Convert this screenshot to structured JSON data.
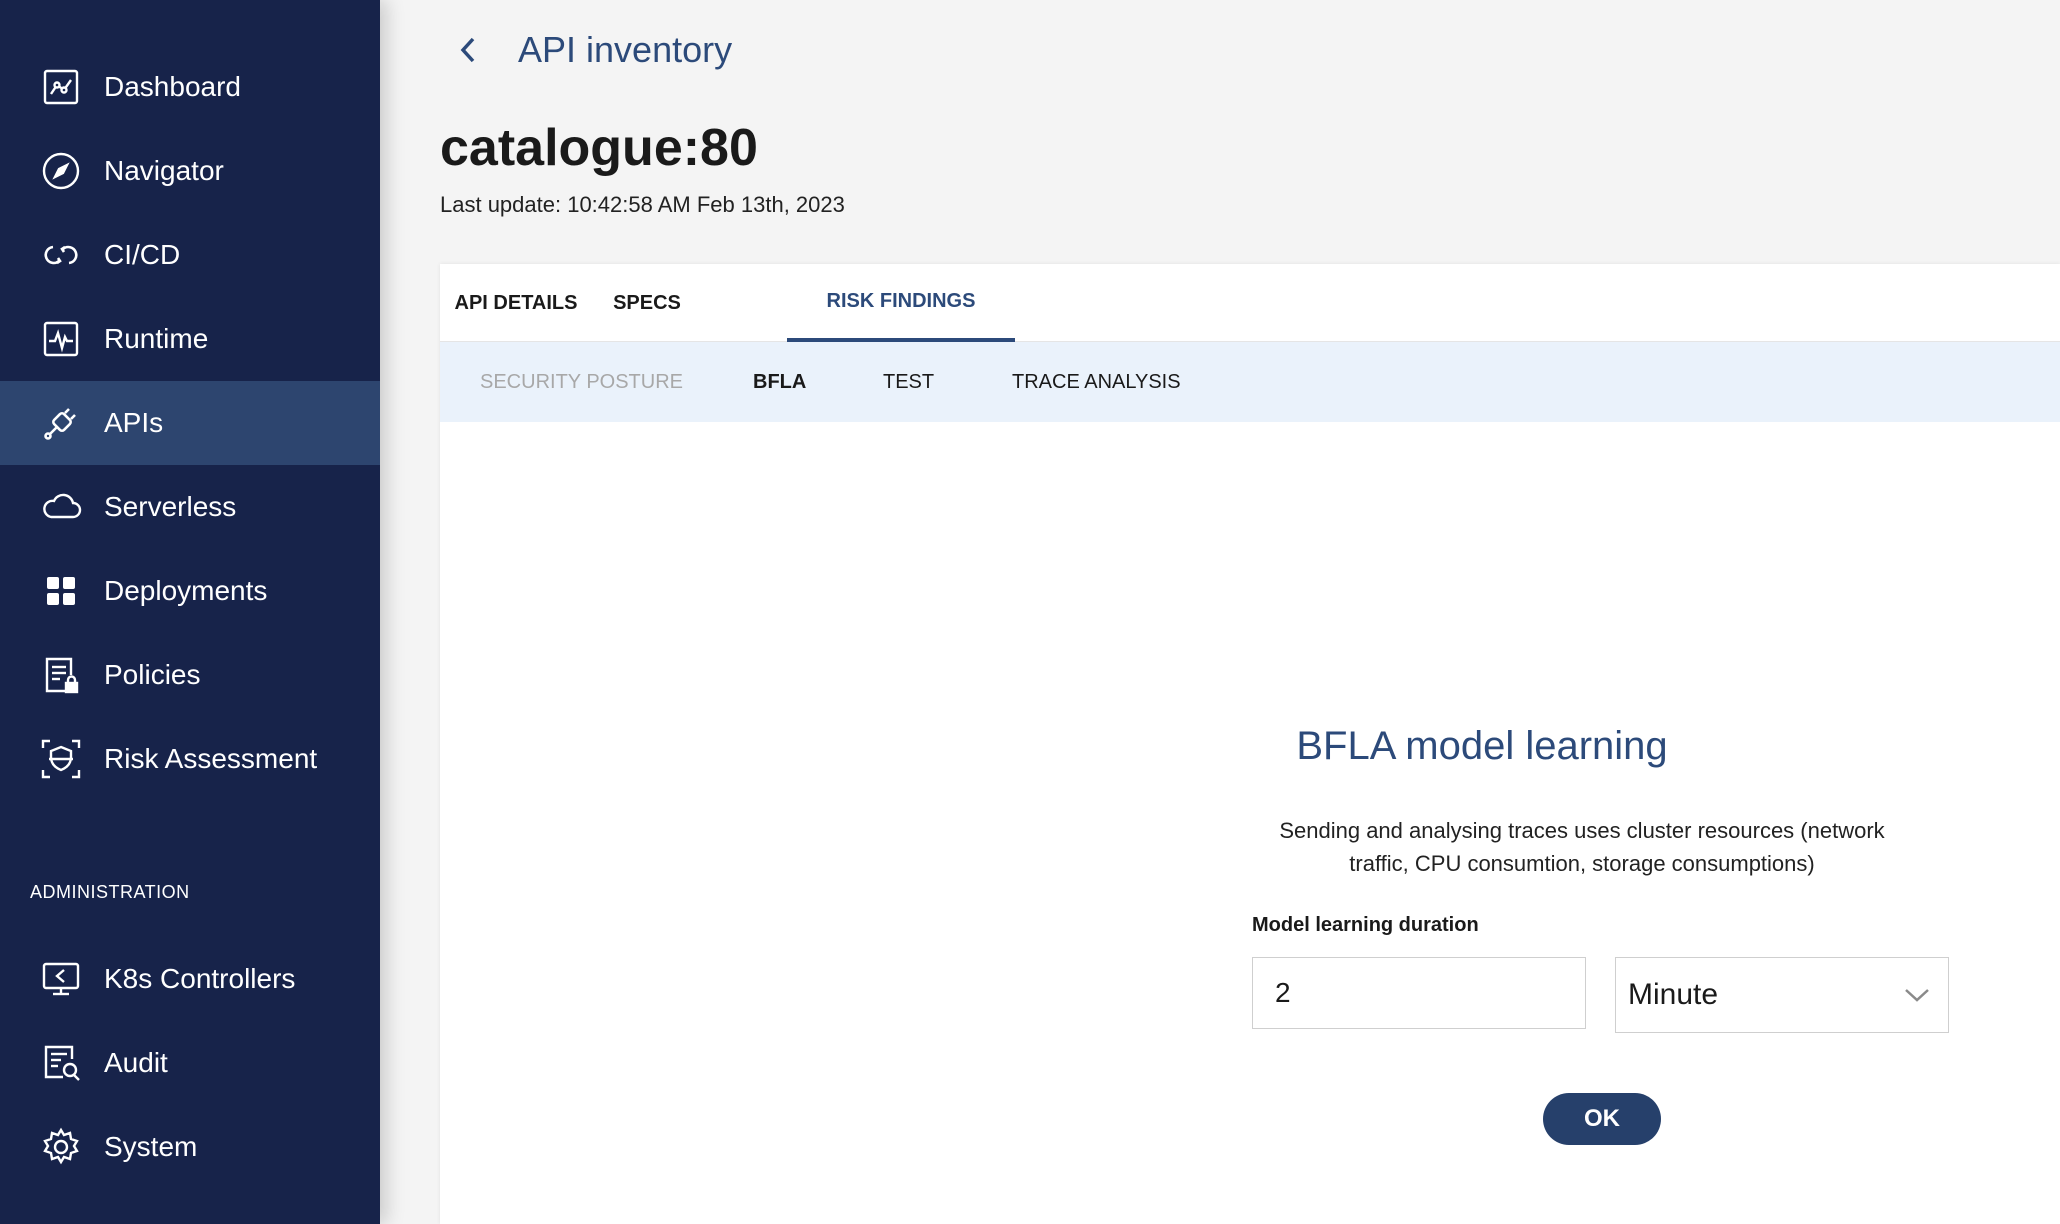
{
  "sidebar": {
    "items": [
      {
        "label": "Dashboard",
        "icon": "dashboard-icon"
      },
      {
        "label": "Navigator",
        "icon": "compass-icon"
      },
      {
        "label": "CI/CD",
        "icon": "cicd-icon"
      },
      {
        "label": "Runtime",
        "icon": "runtime-icon"
      },
      {
        "label": "APIs",
        "icon": "api-plug-icon",
        "active": true
      },
      {
        "label": "Serverless",
        "icon": "cloud-icon"
      },
      {
        "label": "Deployments",
        "icon": "grid-icon"
      },
      {
        "label": "Policies",
        "icon": "policy-lock-icon"
      },
      {
        "label": "Risk Assessment",
        "icon": "shield-scan-icon"
      }
    ],
    "admin_section_label": "ADMINISTRATION",
    "admin_items": [
      {
        "label": "K8s Controllers",
        "icon": "monitor-icon"
      },
      {
        "label": "Audit",
        "icon": "audit-icon"
      },
      {
        "label": "System",
        "icon": "gear-icon"
      }
    ]
  },
  "header": {
    "breadcrumb": "API inventory",
    "title": "catalogue:80",
    "last_update": "Last update: 10:42:58 AM Feb 13th, 2023"
  },
  "tabs": [
    {
      "label": "API DETAILS"
    },
    {
      "label": "SPECS"
    },
    {
      "label": "RISK FINDINGS",
      "active": true
    }
  ],
  "subtabs": [
    {
      "label": "SECURITY POSTURE",
      "disabled": true
    },
    {
      "label": "BFLA",
      "active": true
    },
    {
      "label": "TEST"
    },
    {
      "label": "TRACE ANALYSIS"
    }
  ],
  "bfla": {
    "title": "BFLA model learning",
    "description": "Sending and analysing traces uses cluster resources (network traffic, CPU consumtion, storage consumptions)",
    "duration_label": "Model learning duration",
    "duration_value": "2",
    "unit_value": "Minute",
    "ok_label": "OK"
  },
  "colors": {
    "sidebar_bg": "#17234a",
    "sidebar_active": "#2d456f",
    "accent": "#2c4a7a",
    "subtab_bg": "#eaf2fb"
  }
}
